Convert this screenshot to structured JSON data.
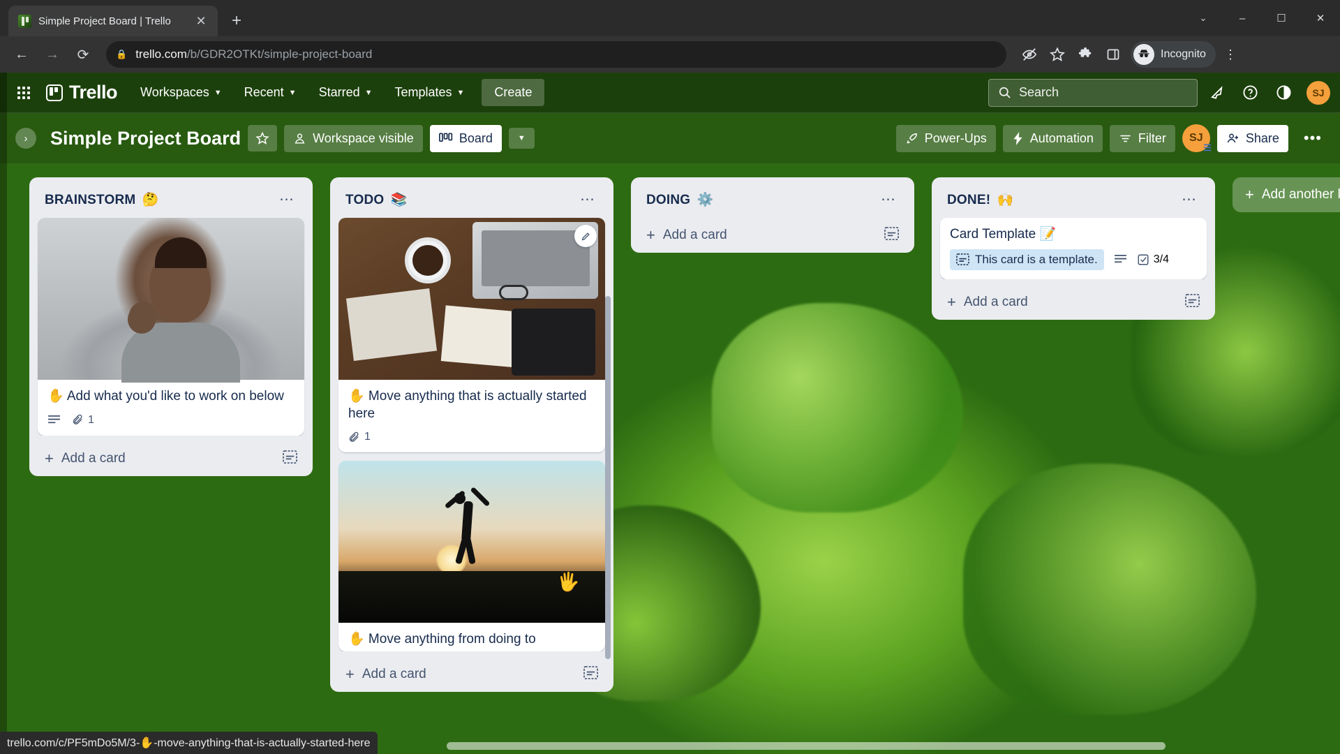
{
  "browser": {
    "tab": {
      "title": "Simple Project Board | Trello",
      "close_icon": "close-icon"
    },
    "new_tab_label": "+",
    "window": {
      "minimize": "–",
      "maximize": "☐",
      "close": "✕",
      "chevron": "⌄"
    },
    "nav": {
      "back": "←",
      "forward": "→",
      "reload": "⟳"
    },
    "url_domain": "trello.com",
    "url_path": "/b/GDR2OTKt/simple-project-board",
    "profile_label": "Incognito"
  },
  "topnav": {
    "apps_icon": "apps-grid-icon",
    "logo_text": "Trello",
    "items": [
      {
        "label": "Workspaces",
        "has_chevron": true
      },
      {
        "label": "Recent",
        "has_chevron": true
      },
      {
        "label": "Starred",
        "has_chevron": true
      },
      {
        "label": "Templates",
        "has_chevron": true
      }
    ],
    "create_label": "Create",
    "search_placeholder": "Search",
    "avatar_initials": "SJ"
  },
  "boardbar": {
    "title": "Simple Project Board",
    "star_icon": "star-icon",
    "visibility_label": "Workspace visible",
    "view_label": "Board",
    "powerups_label": "Power-Ups",
    "automation_label": "Automation",
    "filter_label": "Filter",
    "share_label": "Share",
    "avatar_initials": "SJ",
    "more_label": "•••"
  },
  "board": {
    "add_list_label": "Add another list",
    "add_card_label": "Add a card",
    "lists": [
      {
        "title": "BRAINSTORM",
        "emoji": "🤔",
        "cards": [
          {
            "has_cover": true,
            "cover_type": "photo-person-thinking",
            "text": "✋ Add what you'd like to work on below",
            "badges": [
              {
                "icon": "description-icon",
                "value": ""
              },
              {
                "icon": "attachment-icon",
                "value": "1"
              }
            ]
          }
        ]
      },
      {
        "title": "TODO",
        "emoji": "📚",
        "cards": [
          {
            "has_cover": true,
            "cover_type": "photo-desk-coffee",
            "has_edit_button": true,
            "text": "✋ Move anything that is actually started here",
            "badges": [
              {
                "icon": "attachment-icon",
                "value": "1"
              }
            ]
          },
          {
            "has_cover": true,
            "cover_type": "photo-sunset-jump",
            "text": "✋ Move anything from doing to",
            "badges": []
          }
        ]
      },
      {
        "title": "DOING",
        "emoji": "⚙️",
        "cards": []
      },
      {
        "title": "DONE!",
        "emoji": "🙌",
        "cards": [
          {
            "has_cover": false,
            "text": "Card Template 📝",
            "template_chip": "This card is a template.",
            "badges": [
              {
                "icon": "description-icon",
                "value": ""
              },
              {
                "icon": "checklist-icon",
                "value": "3/4"
              }
            ]
          }
        ]
      }
    ]
  },
  "statusbar": {
    "url": "trello.com/c/PF5mDo5M/3-✋-move-anything-that-is-actually-started-here"
  }
}
